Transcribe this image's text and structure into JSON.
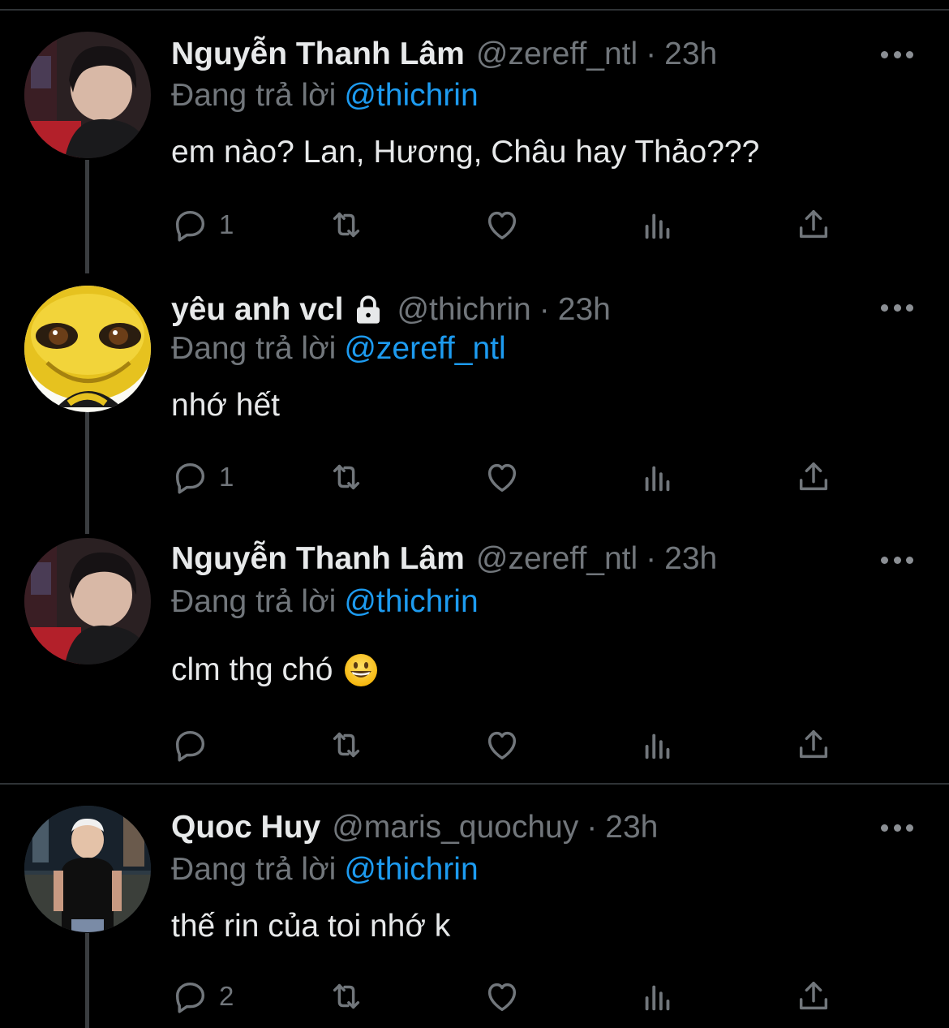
{
  "tweets": [
    {
      "name": "Nguyễn Thanh Lâm",
      "handle": "@zereff_ntl",
      "separator": "·",
      "time": "23h",
      "replying_prefix": "Đang trả lời",
      "replying_to": "@thichrin",
      "text": "em nào? Lan, Hương, Châu hay Thảo???",
      "locked": false,
      "emoji": "",
      "reply_count": "1",
      "avatar": "avatar-person-dark-hair"
    },
    {
      "name": "yêu anh vcl",
      "handle": "@thichrin",
      "separator": "·",
      "time": "23h",
      "replying_prefix": "Đang trả lời",
      "replying_to": "@zereff_ntl",
      "text": "nhớ hết",
      "locked": true,
      "emoji": "",
      "reply_count": "1",
      "avatar": "avatar-yellow-character"
    },
    {
      "name": "Nguyễn Thanh Lâm",
      "handle": "@zereff_ntl",
      "separator": "·",
      "time": "23h",
      "replying_prefix": "Đang trả lời",
      "replying_to": "@thichrin",
      "text": "clm thg chó",
      "locked": false,
      "emoji": "grinning-face",
      "reply_count": "",
      "avatar": "avatar-person-dark-hair"
    },
    {
      "name": "Quoc Huy",
      "handle": "@maris_quochuy",
      "separator": "·",
      "time": "23h",
      "replying_prefix": "Đang trả lời",
      "replying_to": "@thichrin",
      "text": "thế rin của toi nhớ k",
      "locked": false,
      "emoji": "",
      "reply_count": "2",
      "avatar": "avatar-person-night-city"
    }
  ],
  "colors": {
    "background": "#000000",
    "text": "#e7e9ea",
    "muted": "#71767b",
    "link": "#1d9bf0",
    "divider": "#2f3336"
  }
}
